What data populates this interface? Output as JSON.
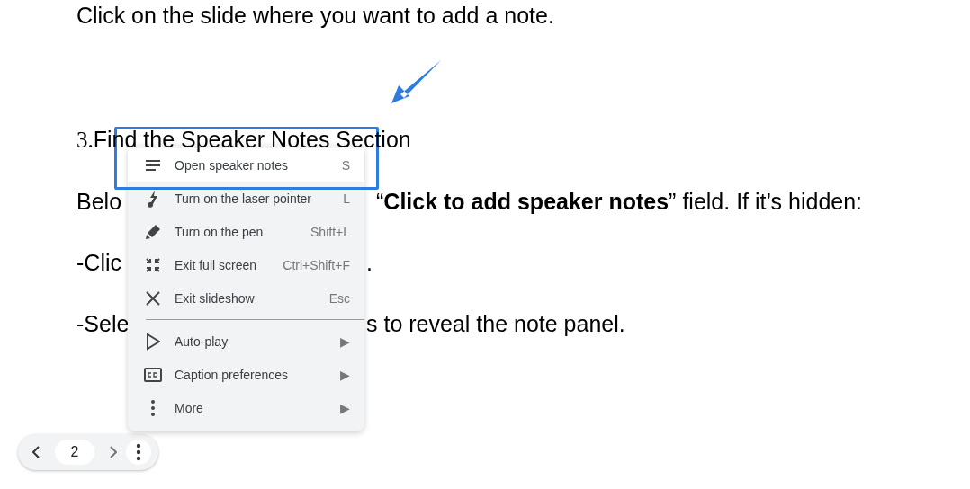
{
  "document": {
    "lines": [
      {
        "kind": "text",
        "segments": [
          "Click on the slide where you want to add a note."
        ]
      },
      {
        "kind": "heading",
        "number": "3.",
        "segments": [
          "Find the Speaker Notes Section"
        ]
      },
      {
        "kind": "text",
        "segments": [
          "Belo",
          "“**Click to add speaker notes**” field. If it’s hidden:"
        ]
      },
      {
        "kind": "text",
        "segments": [
          "-Clic",
          "."
        ]
      },
      {
        "kind": "text",
        "segments": [
          "-Sele",
          "s to reveal the note panel."
        ]
      }
    ]
  },
  "context_menu": {
    "items": [
      {
        "label": "Open speaker notes",
        "shortcut": "S",
        "selected": true
      },
      {
        "label": "Turn on the laser pointer",
        "shortcut": "L",
        "selected": false
      },
      {
        "label": "Turn on the pen",
        "shortcut": "Shift+L",
        "selected": false
      },
      {
        "label": "Exit full screen",
        "shortcut": "Ctrl+Shift+F",
        "selected": false
      },
      {
        "label": "Exit slideshow",
        "shortcut": "Esc",
        "selected": false,
        "divider_after": true
      },
      {
        "label": "Auto-play",
        "shortcut": "▶",
        "selected": false
      },
      {
        "label": "Caption preferences",
        "shortcut": "▶",
        "selected": false
      },
      {
        "label": "More",
        "shortcut": "▶",
        "selected": false
      }
    ]
  },
  "pager": {
    "page": "2"
  }
}
